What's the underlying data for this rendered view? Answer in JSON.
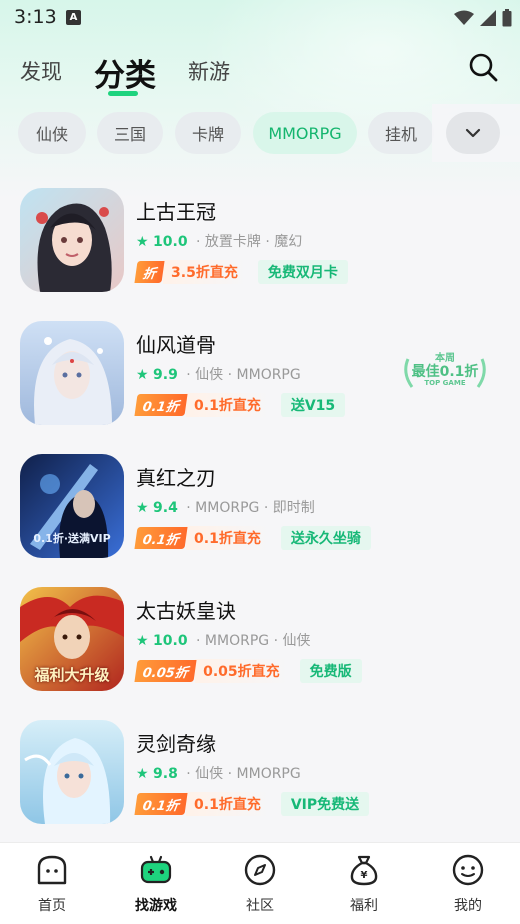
{
  "status_bar": {
    "time": "3:13",
    "notif_letter": "A"
  },
  "top_tabs": [
    "发现",
    "分类",
    "新游"
  ],
  "active_tab": "分类",
  "chips": [
    "仙侠",
    "三国",
    "卡牌",
    "MMORPG",
    "挂机"
  ],
  "active_chip": "MMORPG",
  "games": [
    {
      "name": "上古王冠",
      "score": "10.0",
      "meta": "· 放置卡牌 · 魔幻",
      "discount_badge": "折",
      "discount_text": "3.5折直充",
      "perk": "免费双月卡"
    },
    {
      "name": "仙风道骨",
      "score": "9.9",
      "meta": "· 仙侠 · MMORPG",
      "discount_badge": "0.1折",
      "discount_text": "0.1折直充",
      "perk": "送V15",
      "best_badge": {
        "line1": "本周",
        "line2": "最佳0.1折",
        "line3": "TOP GAME"
      }
    },
    {
      "name": "真红之刃",
      "score": "9.4",
      "meta": "· MMORPG · 即时制",
      "discount_badge": "0.1折",
      "discount_text": "0.1折直充",
      "perk": "送永久坐骑",
      "icon_caption": "0.1折·送满VIP"
    },
    {
      "name": "太古妖皇诀",
      "score": "10.0",
      "meta": "· MMORPG · 仙侠",
      "discount_badge": "0.05折",
      "discount_text": "0.05折直充",
      "perk": "免费版",
      "icon_caption": "福利大升级"
    },
    {
      "name": "灵剑奇缘",
      "score": "9.8",
      "meta": "· 仙侠 · MMORPG",
      "discount_badge": "0.1折",
      "discount_text": "0.1折直充",
      "perk": "VIP免费送"
    }
  ],
  "bottom_nav": [
    {
      "label": "首页",
      "icon": "home-icon"
    },
    {
      "label": "找游戏",
      "icon": "gamepad-icon"
    },
    {
      "label": "社区",
      "icon": "compass-icon"
    },
    {
      "label": "福利",
      "icon": "money-bag-icon"
    },
    {
      "label": "我的",
      "icon": "profile-face-icon"
    }
  ],
  "active_nav": "找游戏",
  "colors": {
    "accent": "#1ed37e",
    "discount": "#ff6b2b",
    "perk": "#17b877"
  }
}
